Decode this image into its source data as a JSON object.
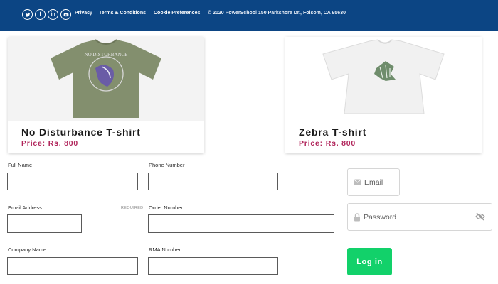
{
  "footer": {
    "social": [
      {
        "name": "twitter",
        "icon": "twitter-icon"
      },
      {
        "name": "facebook",
        "icon": "facebook-icon",
        "glyph": "f"
      },
      {
        "name": "linkedin",
        "icon": "linkedin-icon",
        "glyph": "in"
      },
      {
        "name": "youtube",
        "icon": "youtube-icon"
      }
    ],
    "links": {
      "privacy": "Privacy",
      "terms": "Terms & Conditions",
      "cookies": "Cookie Preferences"
    },
    "copyright": "© 2020 PowerSchool 150 Parkshore Dr., Folsom, CA 95630",
    "background_color": "#0c4584"
  },
  "products": [
    {
      "name": "No Disturbance T-shirt",
      "price": "Price: Rs. 800",
      "shirt_color": "#838f6e",
      "print_text": "NO DISTURBANCE"
    },
    {
      "name": "Zebra T-shirt",
      "price": "Price: Rs. 800",
      "shirt_color": "#f4f4f4"
    }
  ],
  "form": {
    "full_name": {
      "label": "Full Name",
      "value": ""
    },
    "phone_number": {
      "label": "Phone Number",
      "value": ""
    },
    "email_address": {
      "label": "Email Address",
      "required": "REQUIRED",
      "value": ""
    },
    "order_number": {
      "label": "Order Number",
      "value": ""
    },
    "company_name": {
      "label": "Company Name",
      "value": ""
    },
    "rma_number": {
      "label": "RMA Number",
      "value": ""
    }
  },
  "login": {
    "email_placeholder": "Email",
    "password_placeholder": "Password",
    "button_label": "Log in",
    "button_color": "#12d16a"
  },
  "colors": {
    "price": "#b0245a",
    "accent_green": "#12d16a"
  }
}
